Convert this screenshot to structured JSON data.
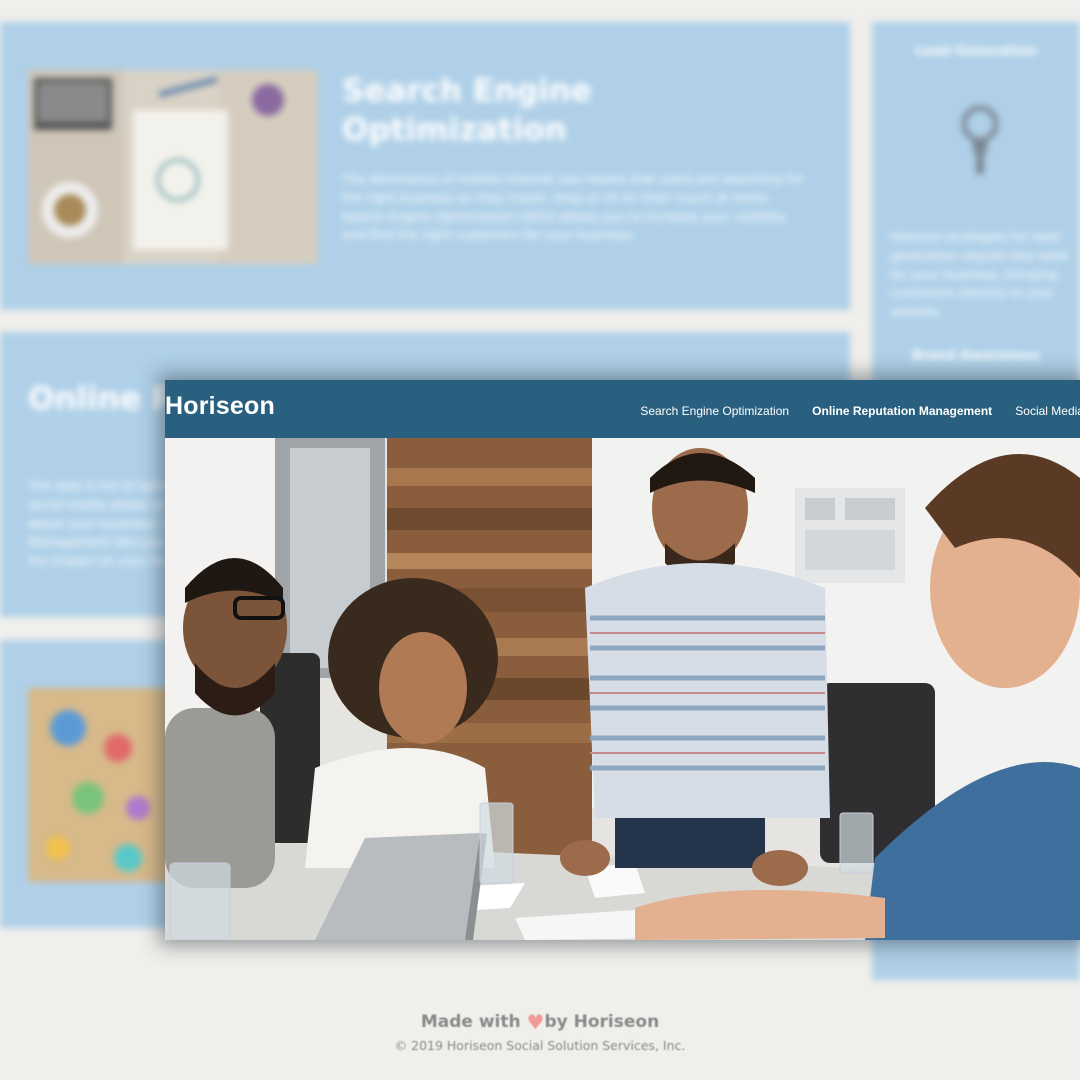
{
  "background_page": {
    "cards": [
      {
        "title": "Search Engine Optimization",
        "text": "The dominance of mobile internet use means that users are searching for the right business as they travel, shop or sit on their couch at home. Search Engine Optimization (SEO) allows you to increase your visibility and find the right customers for your business."
      },
      {
        "title": "Online Reputation Management",
        "text": "The web is full of opinions and information and social media allows anyone to share what they want about your business. Online Reputation Management lets you control over who you are and the impact on your business."
      }
    ],
    "aside": {
      "heading_1": "Lead Generation",
      "text": "Inbound strategies for lead generation require less work for your business, bringing customers directly to your website.",
      "heading_2": "Brand Awareness",
      "icon": "lightbulb-icon"
    }
  },
  "header": {
    "logo": "Horiseon",
    "nav": [
      "Search Engine Optimization",
      "Online Reputation Management",
      "Social Media Marketing"
    ]
  },
  "hero": {
    "icon": "team-meeting-photo"
  },
  "footer": {
    "made_with": "Made with ",
    "heart_icon": "heart-icon",
    "by": "by Horiseon",
    "copyright": "© 2019 Horiseon Social Solution Services, Inc."
  },
  "colors": {
    "header": "#2a607f",
    "card": "#afd0e8",
    "page_bg": "#f0efec",
    "footer_text": "#8a8a8a",
    "heart": "#f19a9a"
  }
}
